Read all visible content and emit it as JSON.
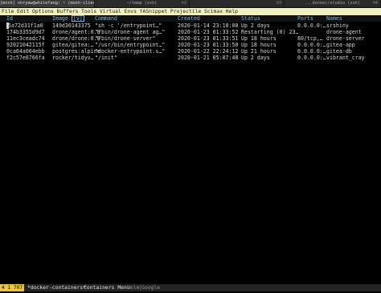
{
  "tabs": [
    {
      "title": "[mosh] shryaw@whitefang: ~ (mosh-client)",
      "key": ""
    },
    {
      "title": "~/temp (zsh)",
      "key": "⌘2"
    },
    {
      "title": "",
      "key": "⌘3"
    },
    {
      "title": "...docker/studio (zsh)",
      "key": "⌘4"
    }
  ],
  "menu": [
    "File",
    "Edit",
    "Options",
    "Buffers",
    "Tools",
    "Virtual Envs",
    "YASnippet",
    "Projectile",
    "Scimax",
    "Help"
  ],
  "table": {
    "columns": [
      "Id",
      "Image",
      "Command",
      "Created",
      "Status",
      "Ports",
      "Names"
    ],
    "sort_indicator": "[v]",
    "rows": [
      {
        "id": "5a72d31f1a0",
        "image": "149d30143375",
        "command": "\"sh -c '/entrypoint…\"",
        "created": "2020-01-14 23:10:00",
        "status": "Up 2 days",
        "ports": "0.0.0.0:…",
        "names": "srshiny"
      },
      {
        "id": "174b3355d9d7",
        "image": "drone/agent:0.8",
        "command": "\"/bin/drone-agent ag…\"",
        "created": "2020-01-23 01:33:52",
        "status": "Restarting (0) 23…",
        "ports": "",
        "names": "drone-agent"
      },
      {
        "id": "11ec3ceadc74",
        "image": "drone/drone:0.8",
        "command": "\"/bin/drone-server\"",
        "created": "2020-01-23 01:33:51",
        "status": "Up 18 hours",
        "ports": "80/tcp,…",
        "names": "drone-server"
      },
      {
        "id": "92021042115f",
        "image": "gitea/gitea:…",
        "command": "\"/usr/bin/entrypoint…\"",
        "created": "2020-01-23 01:33:50",
        "status": "Up 18 hours",
        "ports": "0.0.0.0:…",
        "names": "gitea-app"
      },
      {
        "id": "0ca64a004ebb",
        "image": "postgres:alpine",
        "command": "\"docker-entrypoint.s…\"",
        "created": "2020-01-22 22:24:12",
        "status": "Up 21 hours",
        "ports": "0.0.0.0:…",
        "names": "gitea-db"
      },
      {
        "id": "f2c57e6766fa",
        "image": "rocker/tidyv…",
        "command": "\"/init\"",
        "created": "2020-01-21 05:07:48",
        "status": "Up 2 days",
        "ports": "0.0.0.0:…",
        "names": "vibrant_cray"
      }
    ]
  },
  "modeline": {
    "position": "4 1 707",
    "buffer": "*docker-containers*",
    "mode": "Containers Menu",
    "helm": "Helm",
    "google": "Google"
  },
  "colors": {
    "menubar_bg": "#f2f0c2",
    "header_fg": "#7fb3d8",
    "position_bg": "#e7c547"
  }
}
